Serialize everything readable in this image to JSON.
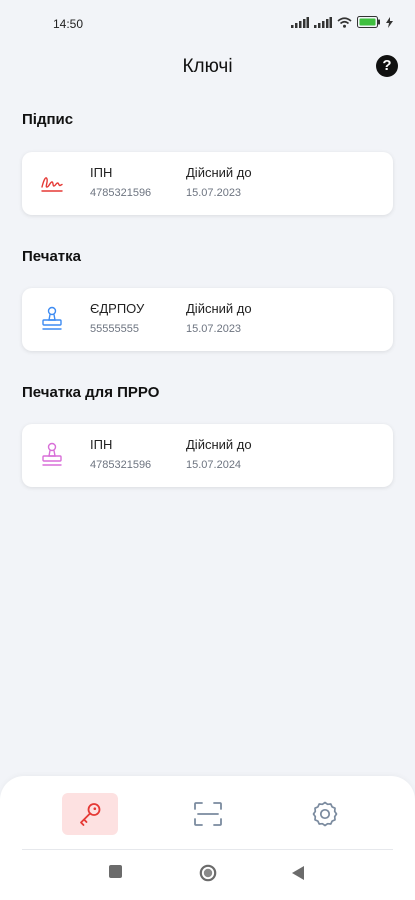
{
  "status_bar": {
    "time": "14:50",
    "icons": [
      "signal-icon",
      "signal-icon",
      "wifi-icon",
      "battery-icon",
      "charging-icon"
    ]
  },
  "header": {
    "title": "Ключі",
    "help_icon": "question-icon",
    "help_glyph": "?"
  },
  "sections": [
    {
      "title": "Підпис",
      "icon": "signature-icon",
      "icon_color": "#e53935",
      "id_label": "ІПН",
      "id_value": "4785321596",
      "valid_label": "Дійсний до",
      "valid_value": "15.07.2023"
    },
    {
      "title": "Печатка",
      "icon": "stamp-icon",
      "icon_color": "#3d8bf2",
      "id_label": "ЄДРПОУ",
      "id_value": "55555555",
      "valid_label": "Дійсний до",
      "valid_value": "15.07.2023"
    },
    {
      "title": "Печатка для ПРРО",
      "icon": "stamp-icon",
      "icon_color": "#d86fd8",
      "id_label": "ІПН",
      "id_value": "4785321596",
      "valid_label": "Дійсний до",
      "valid_value": "15.07.2024"
    }
  ],
  "bottom_nav": {
    "items": [
      {
        "name": "keys",
        "icon": "key-icon",
        "active": true
      },
      {
        "name": "scan",
        "icon": "scan-icon",
        "active": false
      },
      {
        "name": "settings",
        "icon": "gear-icon",
        "active": false
      }
    ],
    "accent_color": "#e53935",
    "inactive_color": "#7a8a9e"
  },
  "system_nav": [
    "square-icon",
    "circle-icon",
    "back-triangle-icon"
  ]
}
